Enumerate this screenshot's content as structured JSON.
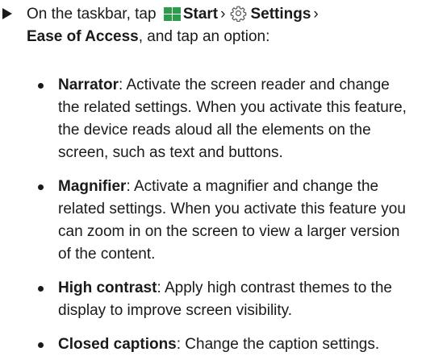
{
  "instruction": {
    "prefix": "On the taskbar, tap",
    "start_label": "Start",
    "separator": "›",
    "settings_label": "Settings",
    "ease_label": "Ease of Access",
    "suffix": ", and tap an option:",
    "start_icon": "windows-start-icon",
    "settings_icon": "gear-icon"
  },
  "colors": {
    "start_icon": "#2e9c4c",
    "text": "#1a1a1a"
  },
  "options": [
    {
      "term": "Narrator",
      "description": ": Activate the screen reader and change the related settings. When you activate this feature, the device reads aloud all the elements on the screen, such as text and buttons."
    },
    {
      "term": "Magnifier",
      "description": ": Activate a magnifier and change the related settings. When you activate this feature you can zoom in on the screen to view a larger version of the content."
    },
    {
      "term": "High contrast",
      "description": ": Apply high contrast themes to the display to improve screen visibility."
    },
    {
      "term": "Closed captions",
      "description": ": Change the caption settings."
    }
  ]
}
